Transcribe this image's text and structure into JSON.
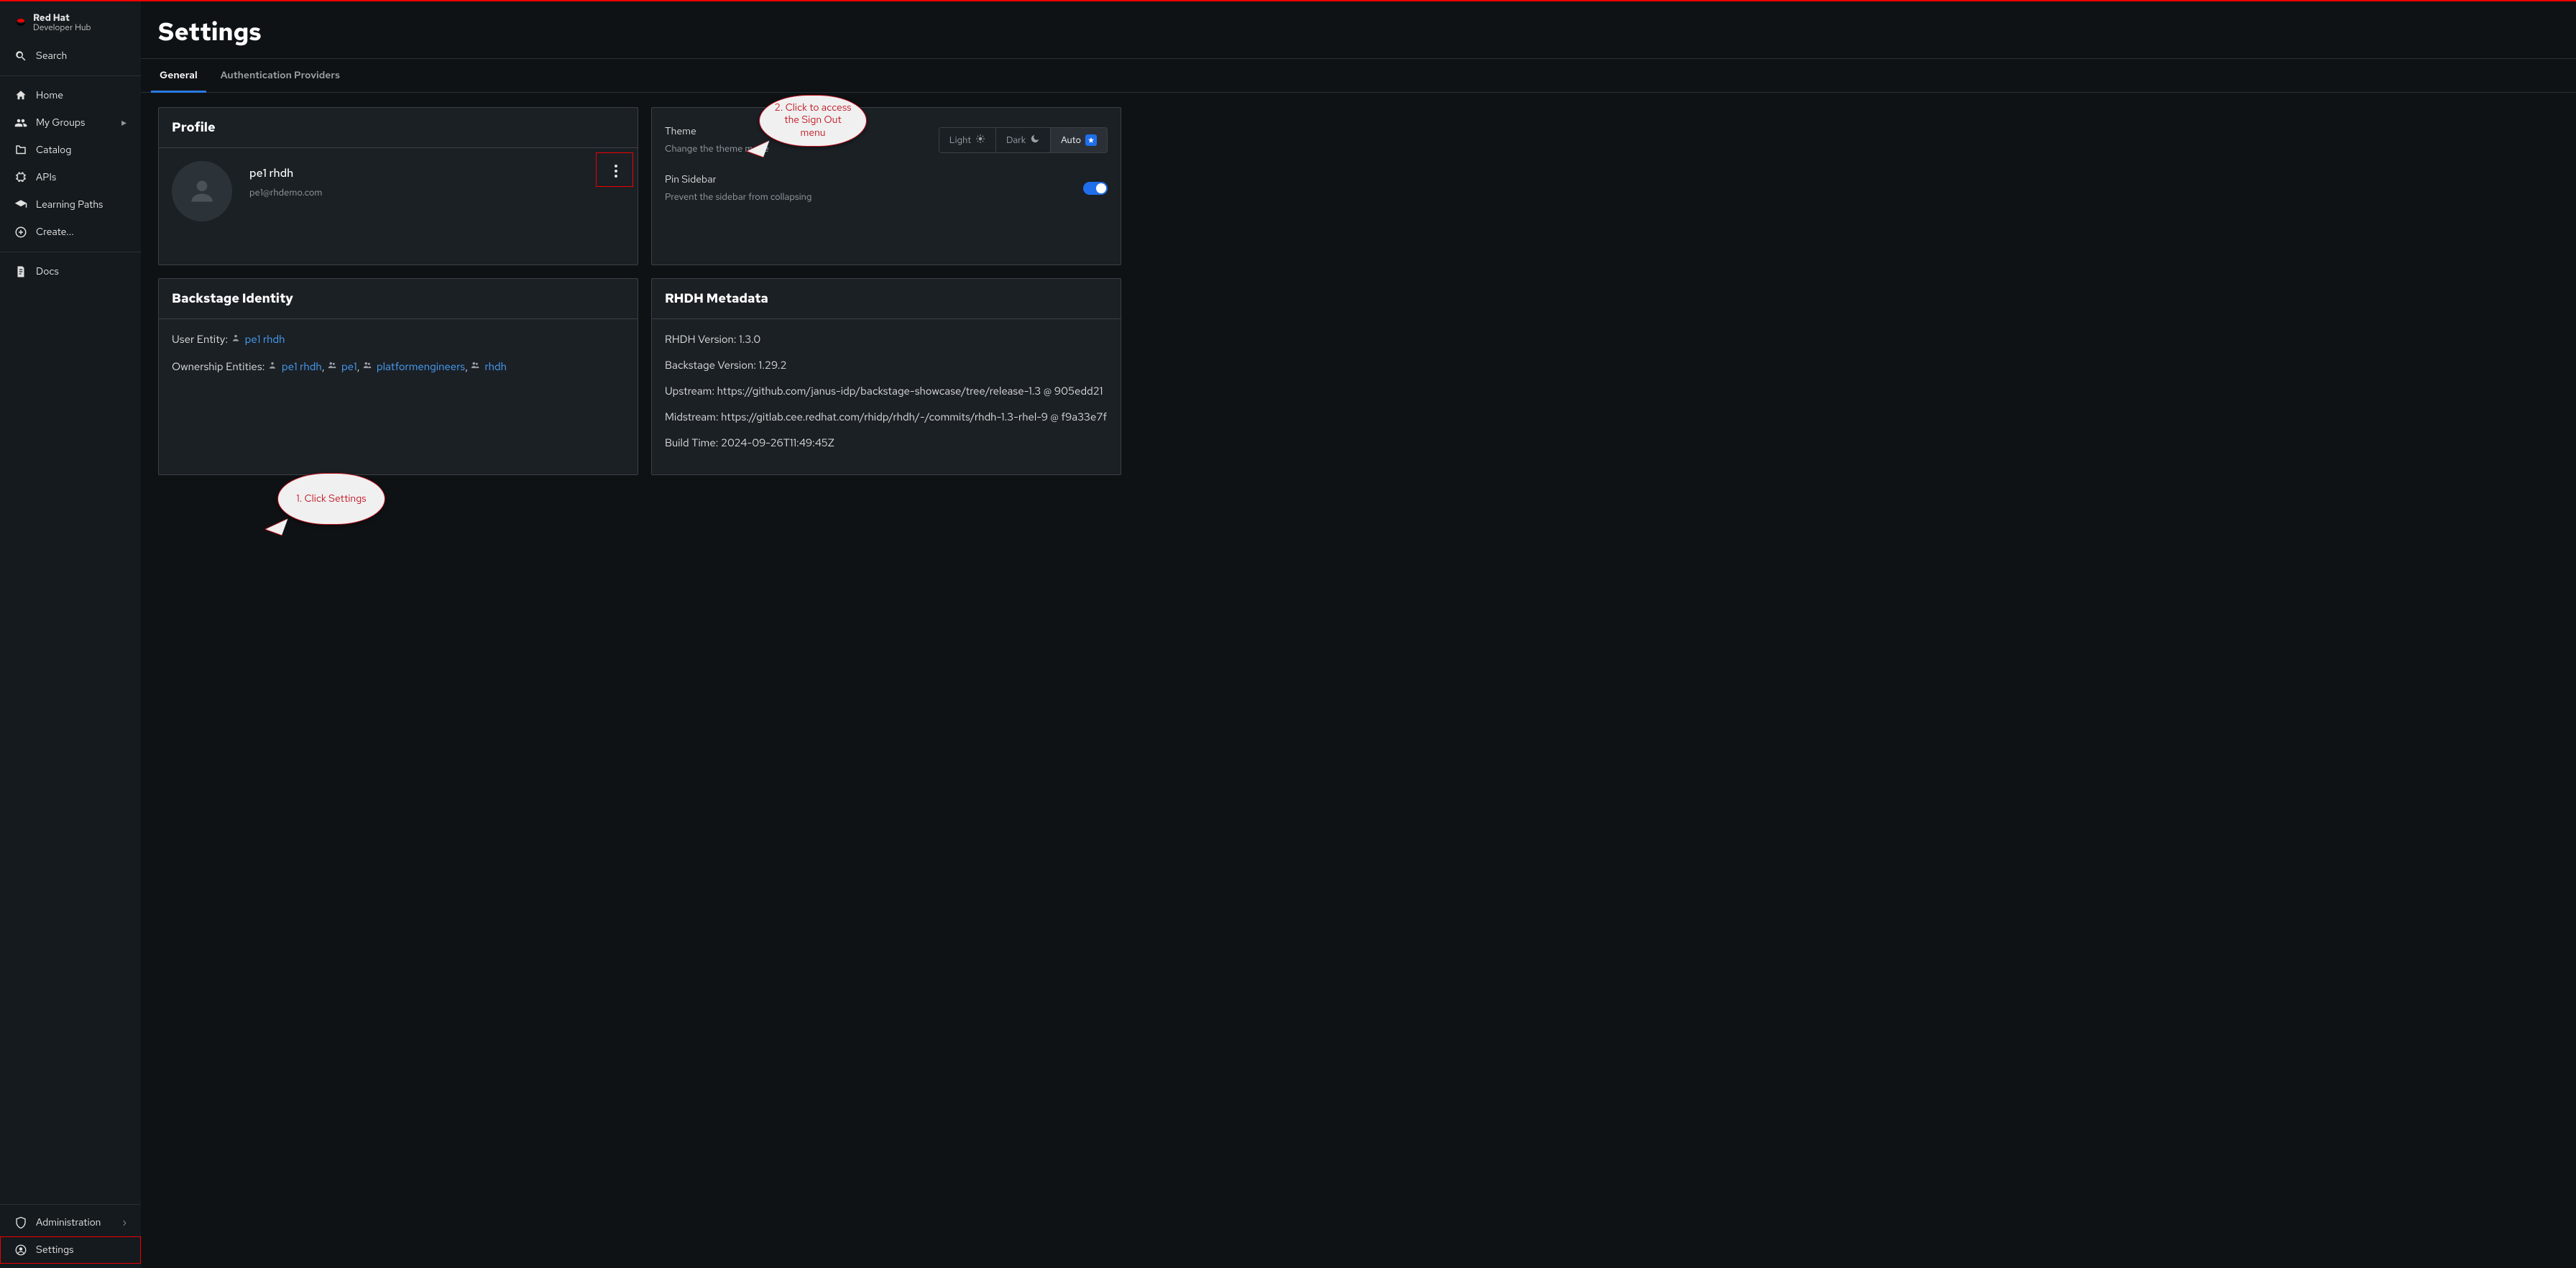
{
  "brand": {
    "top": "Red Hat",
    "sub": "Developer Hub"
  },
  "sidebar": {
    "search": "Search",
    "items": [
      {
        "label": "Home"
      },
      {
        "label": "My Groups",
        "hasSub": true
      },
      {
        "label": "Catalog"
      },
      {
        "label": "APIs"
      },
      {
        "label": "Learning Paths"
      },
      {
        "label": "Create..."
      }
    ],
    "docs": "Docs",
    "administration": "Administration",
    "settings": "Settings"
  },
  "page": {
    "title": "Settings"
  },
  "tabs": {
    "general": "General",
    "auth": "Authentication Providers",
    "active": "general"
  },
  "profile": {
    "header": "Profile",
    "name": "pe1 rhdh",
    "email": "pe1@rhdemo.com"
  },
  "appearance": {
    "theme_label": "Theme",
    "theme_sub": "Change the theme mode",
    "light": "Light",
    "dark": "Dark",
    "auto": "Auto",
    "pin_label": "Pin Sidebar",
    "pin_sub": "Prevent the sidebar from collapsing",
    "pin_on": true
  },
  "identity": {
    "header": "Backstage Identity",
    "user_entity_label": "User Entity:",
    "user_entity": "pe1 rhdh",
    "ownership_label": "Ownership Entities:",
    "ownership": [
      "pe1 rhdh",
      "pe1",
      "platformengineers",
      "rhdh"
    ]
  },
  "metadata": {
    "header": "RHDH Metadata",
    "lines": {
      "rhdh_version_k": "RHDH Version: ",
      "rhdh_version_v": "1.3.0",
      "backstage_version_k": "Backstage Version: ",
      "backstage_version_v": "1.29.2",
      "upstream_k": "Upstream: ",
      "upstream_v": "https://github.com/janus-idp/backstage-showcase/tree/release-1.3 @ 905edd21",
      "midstream_k": "Midstream: ",
      "midstream_v": "https://gitlab.cee.redhat.com/rhidp/rhdh/-/commits/rhdh-1.3-rhel-9 @ f9a33e7f",
      "build_time_k": "Build Time: ",
      "build_time_v": "2024-09-26T11:49:45Z"
    }
  },
  "annotations": {
    "a1": "1. Click Settings",
    "a2": "2. Click to access the Sign Out menu"
  }
}
